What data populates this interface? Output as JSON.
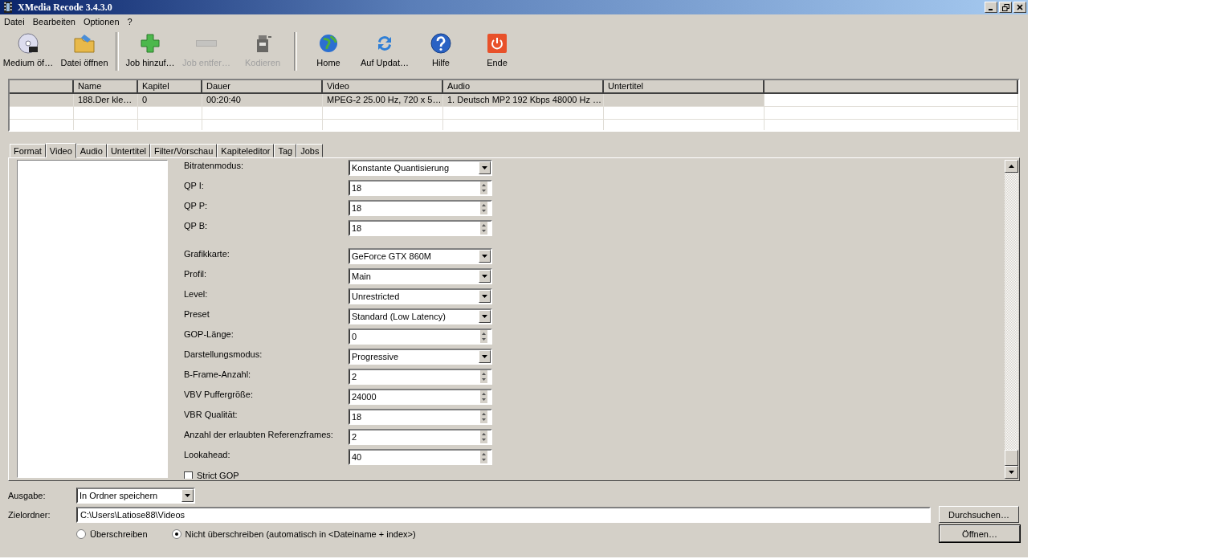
{
  "window": {
    "title": "XMedia Recode 3.4.3.0"
  },
  "menu": [
    "Datei",
    "Bearbeiten",
    "Optionen",
    "?"
  ],
  "toolbar": [
    {
      "label": "Medium öf…",
      "disabled": false
    },
    {
      "label": "Datei öffnen",
      "disabled": false
    },
    {
      "label": "Job hinzuf…",
      "disabled": false
    },
    {
      "label": "Job entfer…",
      "disabled": true
    },
    {
      "label": "Kodieren",
      "disabled": true
    },
    {
      "label": "Home",
      "disabled": false
    },
    {
      "label": "Auf Updat…",
      "disabled": false
    },
    {
      "label": "Hilfe",
      "disabled": false
    },
    {
      "label": "Ende",
      "disabled": false
    }
  ],
  "table": {
    "columns": [
      "Name",
      "Kapitel",
      "Dauer",
      "Video",
      "Audio",
      "Untertitel"
    ],
    "rows": [
      {
        "selected": true,
        "cells": [
          "188.Der kle…",
          "0",
          "00:20:40",
          "MPEG-2 25.00 Hz, 720 x 5…",
          "1. Deutsch MP2 192 Kbps 48000 Hz …"
        ]
      }
    ]
  },
  "tabs": [
    {
      "label": "Format",
      "selected": false
    },
    {
      "label": "Video",
      "selected": true
    },
    {
      "label": "Audio",
      "selected": false
    },
    {
      "label": "Untertitel",
      "selected": false
    },
    {
      "label": "Filter/Vorschau",
      "selected": false
    },
    {
      "label": "Kapiteleditor",
      "selected": false
    },
    {
      "label": "Tag",
      "selected": false
    },
    {
      "label": "Jobs",
      "selected": false
    }
  ],
  "settings": [
    {
      "kind": "combo",
      "label": "Bitratenmodus:",
      "value": "Konstante Quantisierung"
    },
    {
      "kind": "spin",
      "label": "QP I:",
      "value": "18"
    },
    {
      "kind": "spin",
      "label": "QP P:",
      "value": "18"
    },
    {
      "kind": "spin",
      "label": "QP B:",
      "value": "18"
    },
    {
      "kind": "gap"
    },
    {
      "kind": "combo",
      "label": "Grafikkarte:",
      "value": "GeForce GTX 860M"
    },
    {
      "kind": "combo",
      "label": "Profil:",
      "value": "Main"
    },
    {
      "kind": "combo",
      "label": "Level:",
      "value": "Unrestricted"
    },
    {
      "kind": "combo",
      "label": "Preset",
      "value": "Standard (Low Latency)"
    },
    {
      "kind": "spin",
      "label": "GOP-Länge:",
      "value": "0"
    },
    {
      "kind": "combo",
      "label": "Darstellungsmodus:",
      "value": "Progressive"
    },
    {
      "kind": "spin",
      "label": "B-Frame-Anzahl:",
      "value": "2"
    },
    {
      "kind": "spin",
      "label": "VBV Puffergröße:",
      "value": "24000"
    },
    {
      "kind": "spin",
      "label": "VBR Qualität:",
      "value": "18"
    },
    {
      "kind": "spin",
      "label": "Anzahl der erlaubten Referenzframes:",
      "value": "2"
    },
    {
      "kind": "spin",
      "label": "Lookahead:",
      "value": "40"
    },
    {
      "kind": "check",
      "label": "Strict GOP",
      "checked": false
    }
  ],
  "output": {
    "label": "Ausgabe:",
    "value": "In Ordner speichern"
  },
  "folder": {
    "label": "Zielordner:",
    "value": "C:\\Users\\Latiose88\\Videos",
    "browse": "Durchsuchen…",
    "open": "Öffnen…"
  },
  "overwrite": [
    {
      "label": "Überschreiben",
      "selected": false
    },
    {
      "label": "Nicht überschreiben (automatisch in <Dateiname + index>)",
      "selected": true
    }
  ]
}
